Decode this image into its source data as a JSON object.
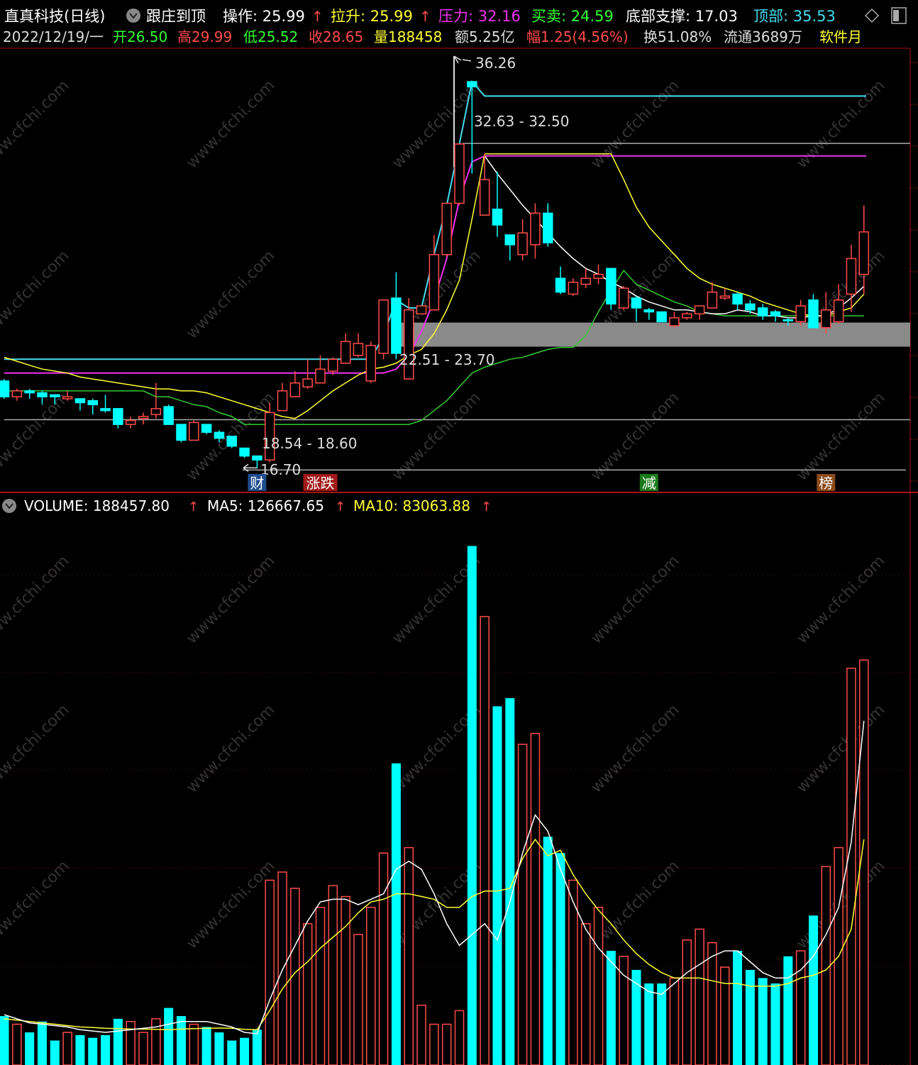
{
  "header": {
    "stock_name": "直真科技(日线)",
    "indicator_name": "跟庄到顶",
    "caozuo": "操作: 25.99",
    "lasheng": "拉升: 25.99",
    "yali": "压力: 32.16",
    "maimai": "买卖: 24.59",
    "dibu": "底部支撑: 17.03",
    "dingbu": "顶部: 35.53"
  },
  "info": {
    "date": "2022/12/19/一",
    "open": "开26.50",
    "high": "高29.99",
    "low": "低25.52",
    "close": "收28.65",
    "volume": "量188458",
    "amount": "额5.25亿",
    "change": "幅1.25(4.56%)",
    "turnover": "换51.08%",
    "float": "流通3689万",
    "sector": "软件月"
  },
  "annotations": {
    "high_label": "36.26",
    "resist_label": "32.63 - 32.50",
    "zone_label": "22.51 - 23.70",
    "support_label": "18.54 - 18.60",
    "low_label": "16.70"
  },
  "event_badges": [
    {
      "text": "财",
      "bg": "#1f4e8f",
      "x": 20
    },
    {
      "text": "涨跌",
      "bg": "#a01818",
      "x": 25
    },
    {
      "text": "减",
      "bg": "#1a7a1a",
      "x": 51
    },
    {
      "text": "榜",
      "bg": "#8a4a1a",
      "x": 65
    }
  ],
  "volume_header": {
    "label": "VOLUME: 188457.80",
    "ma5": "MA5: 126667.65",
    "ma10": "MA10: 83063.88"
  },
  "colors": {
    "up": "#ff4b4b",
    "down": "#00ffff",
    "ma_white": "#ffffff",
    "ma_yellow": "#ffff33",
    "ma_green": "#33cc33",
    "line_cyan": "#44ddee",
    "line_magenta": "#ee33ee",
    "zone_gray": "#8a8a8a",
    "frame": "#aa1111"
  },
  "chart_data": [
    {
      "type": "candlestick",
      "ylim": [
        15.6,
        37.7
      ],
      "candles": [
        {
          "o": 21.1,
          "c": 20.3,
          "h": 21.2,
          "l": 20.2,
          "up": false
        },
        {
          "o": 20.3,
          "c": 20.6,
          "h": 20.7,
          "l": 20.1,
          "up": true
        },
        {
          "o": 20.6,
          "c": 20.5,
          "h": 20.7,
          "l": 20.2,
          "up": false
        },
        {
          "o": 20.5,
          "c": 20.3,
          "h": 20.6,
          "l": 19.9,
          "up": false
        },
        {
          "o": 20.4,
          "c": 20.3,
          "h": 20.4,
          "l": 19.9,
          "up": false
        },
        {
          "o": 20.2,
          "c": 20.3,
          "h": 20.6,
          "l": 20.1,
          "up": true
        },
        {
          "o": 20.2,
          "c": 20.0,
          "h": 20.2,
          "l": 19.6,
          "up": false
        },
        {
          "o": 20.1,
          "c": 19.9,
          "h": 20.2,
          "l": 19.4,
          "up": false
        },
        {
          "o": 19.7,
          "c": 19.6,
          "h": 20.4,
          "l": 19.5,
          "up": false
        },
        {
          "o": 19.7,
          "c": 18.9,
          "h": 19.7,
          "l": 18.7,
          "up": false
        },
        {
          "o": 18.9,
          "c": 19.1,
          "h": 19.3,
          "l": 18.7,
          "up": true
        },
        {
          "o": 19.2,
          "c": 19.3,
          "h": 19.5,
          "l": 18.9,
          "up": true
        },
        {
          "o": 19.4,
          "c": 19.7,
          "h": 21.0,
          "l": 19.2,
          "up": true
        },
        {
          "o": 19.8,
          "c": 18.9,
          "h": 19.9,
          "l": 18.9,
          "up": false
        },
        {
          "o": 18.9,
          "c": 18.1,
          "h": 18.9,
          "l": 18.0,
          "up": false
        },
        {
          "o": 18.1,
          "c": 19.0,
          "h": 19.1,
          "l": 18.1,
          "up": true
        },
        {
          "o": 18.9,
          "c": 18.5,
          "h": 18.9,
          "l": 18.4,
          "up": false
        },
        {
          "o": 18.5,
          "c": 18.2,
          "h": 18.6,
          "l": 18.0,
          "up": false
        },
        {
          "o": 18.3,
          "c": 17.8,
          "h": 18.3,
          "l": 17.7,
          "up": false
        },
        {
          "o": 17.7,
          "c": 17.3,
          "h": 17.7,
          "l": 17.2,
          "up": false
        },
        {
          "o": 17.3,
          "c": 17.1,
          "h": 17.3,
          "l": 16.7,
          "up": false
        },
        {
          "o": 17.1,
          "c": 19.5,
          "h": 20.0,
          "l": 17.0,
          "up": true
        },
        {
          "o": 19.6,
          "c": 20.6,
          "h": 21.0,
          "l": 19.6,
          "up": true
        },
        {
          "o": 20.3,
          "c": 21.0,
          "h": 21.6,
          "l": 20.3,
          "up": true
        },
        {
          "o": 20.8,
          "c": 21.2,
          "h": 22.2,
          "l": 20.7,
          "up": true
        },
        {
          "o": 21.0,
          "c": 21.7,
          "h": 22.4,
          "l": 21.0,
          "up": true
        },
        {
          "o": 21.6,
          "c": 22.2,
          "h": 22.3,
          "l": 21.4,
          "up": true
        },
        {
          "o": 22.0,
          "c": 23.1,
          "h": 23.5,
          "l": 22.0,
          "up": true
        },
        {
          "o": 22.4,
          "c": 23.0,
          "h": 23.5,
          "l": 22.3,
          "up": true
        },
        {
          "o": 21.1,
          "c": 22.9,
          "h": 23.1,
          "l": 21.0,
          "up": true
        },
        {
          "o": 22.5,
          "c": 25.2,
          "h": 25.2,
          "l": 22.2,
          "up": true
        },
        {
          "o": 25.3,
          "c": 22.5,
          "h": 26.6,
          "l": 22.2,
          "up": false
        },
        {
          "o": 21.2,
          "c": 24.7,
          "h": 25.3,
          "l": 21.2,
          "up": true
        },
        {
          "o": 24.5,
          "c": 24.9,
          "h": 24.9,
          "l": 24.5,
          "up": true
        },
        {
          "o": 24.7,
          "c": 27.5,
          "h": 28.5,
          "l": 24.8,
          "up": true
        },
        {
          "o": 27.5,
          "c": 30.1,
          "h": 30.1,
          "l": 27.4,
          "up": true
        },
        {
          "o": 30.1,
          "c": 33.1,
          "h": 33.1,
          "l": 30.0,
          "up": true
        },
        {
          "o": 36.26,
          "c": 36.0,
          "h": 36.26,
          "l": 31.6,
          "up": false
        },
        {
          "o": 29.5,
          "c": 31.3,
          "h": 32.63,
          "l": 29.5,
          "up": true
        },
        {
          "o": 29.8,
          "c": 29.0,
          "h": 31.7,
          "l": 28.4,
          "up": false
        },
        {
          "o": 28.5,
          "c": 28.0,
          "h": 28.5,
          "l": 27.2,
          "up": false
        },
        {
          "o": 27.5,
          "c": 28.6,
          "h": 29.3,
          "l": 27.2,
          "up": true
        },
        {
          "o": 28.0,
          "c": 29.6,
          "h": 30.1,
          "l": 27.3,
          "up": true
        },
        {
          "o": 29.6,
          "c": 28.1,
          "h": 30.1,
          "l": 27.9,
          "up": false
        },
        {
          "o": 26.3,
          "c": 25.6,
          "h": 26.9,
          "l": 25.5,
          "up": false
        },
        {
          "o": 25.5,
          "c": 26.1,
          "h": 26.3,
          "l": 25.4,
          "up": true
        },
        {
          "o": 26.0,
          "c": 26.3,
          "h": 26.8,
          "l": 25.8,
          "up": true
        },
        {
          "o": 26.3,
          "c": 26.5,
          "h": 27.0,
          "l": 26.0,
          "up": true
        },
        {
          "o": 26.8,
          "c": 25.0,
          "h": 26.8,
          "l": 24.7,
          "up": false
        },
        {
          "o": 24.8,
          "c": 25.8,
          "h": 25.9,
          "l": 24.7,
          "up": true
        },
        {
          "o": 25.3,
          "c": 24.8,
          "h": 25.4,
          "l": 24.1,
          "up": false
        },
        {
          "o": 24.7,
          "c": 24.6,
          "h": 24.8,
          "l": 24.2,
          "up": false
        },
        {
          "o": 24.6,
          "c": 24.1,
          "h": 24.6,
          "l": 24.1,
          "up": false
        },
        {
          "o": 23.9,
          "c": 24.3,
          "h": 24.6,
          "l": 23.8,
          "up": true
        },
        {
          "o": 24.3,
          "c": 24.5,
          "h": 24.6,
          "l": 24.2,
          "up": true
        },
        {
          "o": 24.5,
          "c": 24.9,
          "h": 24.9,
          "l": 24.2,
          "up": true
        },
        {
          "o": 24.8,
          "c": 25.6,
          "h": 26.1,
          "l": 24.8,
          "up": true
        },
        {
          "o": 25.3,
          "c": 25.4,
          "h": 25.8,
          "l": 25.2,
          "up": true
        },
        {
          "o": 25.5,
          "c": 25.0,
          "h": 25.6,
          "l": 24.7,
          "up": false
        },
        {
          "o": 25.0,
          "c": 24.7,
          "h": 25.2,
          "l": 24.5,
          "up": false
        },
        {
          "o": 24.8,
          "c": 24.4,
          "h": 25.0,
          "l": 24.2,
          "up": false
        },
        {
          "o": 24.6,
          "c": 24.4,
          "h": 24.7,
          "l": 24.1,
          "up": false
        },
        {
          "o": 24.2,
          "c": 24.2,
          "h": 24.3,
          "l": 23.9,
          "up": false
        },
        {
          "o": 24.1,
          "c": 24.9,
          "h": 25.2,
          "l": 23.9,
          "up": true
        },
        {
          "o": 25.2,
          "c": 23.8,
          "h": 25.5,
          "l": 23.8,
          "up": false
        },
        {
          "o": 23.8,
          "c": 24.7,
          "h": 25.6,
          "l": 23.5,
          "up": true
        },
        {
          "o": 24.1,
          "c": 25.2,
          "h": 26.0,
          "l": 24.0,
          "up": true
        },
        {
          "o": 25.5,
          "c": 27.3,
          "h": 28.0,
          "l": 24.6,
          "up": true
        },
        {
          "o": 26.5,
          "c": 28.65,
          "h": 29.99,
          "l": 25.52,
          "up": true
        }
      ],
      "ma_white": [
        null,
        null,
        null,
        null,
        null,
        null,
        null,
        null,
        null,
        null,
        null,
        null,
        null,
        null,
        null,
        null,
        null,
        null,
        null,
        null,
        null,
        null,
        null,
        null,
        null,
        null,
        null,
        null,
        null,
        null,
        null,
        null,
        null,
        null,
        null,
        null,
        null,
        null,
        32.5,
        31.6,
        30.8,
        30.0,
        29.3,
        28.6,
        27.9,
        27.3,
        26.8,
        26.5,
        26.1,
        25.8,
        25.4,
        25.1,
        24.9,
        24.7,
        24.7,
        24.6,
        24.5,
        24.5,
        24.7,
        24.6,
        24.4,
        24.4,
        24.3,
        24.3,
        24.4,
        24.4,
        24.8,
        25.3,
        25.9
      ],
      "ma_yellow": [
        22.3,
        22.1,
        21.9,
        21.7,
        21.6,
        21.5,
        21.3,
        21.2,
        21.1,
        21.0,
        20.9,
        20.8,
        20.7,
        20.7,
        20.6,
        20.6,
        20.5,
        20.3,
        20.1,
        19.9,
        19.7,
        19.5,
        19.3,
        19.2,
        19.6,
        20.1,
        20.6,
        21.0,
        21.4,
        21.7,
        21.8,
        22.0,
        22.4,
        22.7,
        23.5,
        24.7,
        26.2,
        29.3,
        32.6,
        32.6,
        32.6,
        32.6,
        32.6,
        32.6,
        32.6,
        32.6,
        32.6,
        32.6,
        32.6,
        31.3,
        29.9,
        28.9,
        28.2,
        27.5,
        26.8,
        26.3,
        26.0,
        25.8,
        25.6,
        25.4,
        25.1,
        24.9,
        24.7,
        24.5,
        24.4,
        24.4,
        24.6,
        24.8,
        25.5
      ],
      "ma_green": [
        20.6,
        20.6,
        20.6,
        20.6,
        20.6,
        20.6,
        20.6,
        20.6,
        20.6,
        20.6,
        20.6,
        20.6,
        20.3,
        20.3,
        20.1,
        19.9,
        19.8,
        19.5,
        19.3,
        18.9,
        18.9,
        18.9,
        18.9,
        18.9,
        18.9,
        18.9,
        18.9,
        18.9,
        18.9,
        18.9,
        18.9,
        18.9,
        18.9,
        19.1,
        19.6,
        20.1,
        20.8,
        21.5,
        21.8,
        22.0,
        22.2,
        22.3,
        22.5,
        22.7,
        22.8,
        22.8,
        23.4,
        24.6,
        25.7,
        26.7,
        26.0,
        25.7,
        25.4,
        25.1,
        24.9,
        24.6,
        24.5,
        24.4,
        24.4,
        24.4,
        24.4,
        24.4,
        24.4,
        24.4,
        24.4,
        24.4,
        24.4,
        24.4,
        24.4
      ],
      "line_cyan": [
        22.2,
        22.2,
        22.2,
        22.2,
        22.2,
        22.2,
        22.2,
        22.2,
        22.2,
        22.2,
        22.2,
        22.2,
        22.2,
        22.2,
        22.2,
        22.2,
        22.2,
        22.2,
        22.2,
        22.2,
        22.2,
        22.2,
        22.2,
        22.2,
        22.2,
        22.2,
        22.2,
        22.2,
        22.2,
        22.2,
        23.4,
        25.2,
        24.8,
        24.8,
        27.5,
        30.0,
        33.1,
        36.26,
        35.53,
        35.53,
        35.53,
        35.53,
        35.53,
        35.53,
        35.53,
        35.53,
        35.53,
        35.53,
        35.53,
        35.53,
        35.53,
        35.53,
        35.53,
        35.53,
        35.53,
        35.53,
        35.53,
        35.53,
        35.53,
        35.53,
        35.53,
        35.53,
        35.53,
        35.53,
        35.53,
        35.53,
        35.53,
        35.53,
        35.53
      ],
      "line_magenta": [
        21.5,
        21.5,
        21.5,
        21.5,
        21.5,
        21.5,
        21.5,
        21.5,
        21.5,
        21.5,
        21.5,
        21.5,
        21.5,
        21.5,
        21.5,
        21.5,
        21.5,
        21.5,
        21.5,
        21.5,
        21.5,
        21.5,
        21.5,
        21.5,
        21.5,
        21.5,
        21.5,
        21.5,
        21.5,
        21.5,
        21.5,
        21.7,
        22.4,
        23.6,
        25.2,
        27.3,
        30.3,
        32.2,
        32.5,
        32.5,
        32.5,
        32.5,
        32.5,
        32.5,
        32.5,
        32.5,
        32.5,
        32.5,
        32.5,
        32.5,
        32.5,
        32.5,
        32.5,
        32.5,
        32.5,
        32.5,
        32.5,
        32.5,
        32.5,
        32.5,
        32.5,
        32.5,
        32.5,
        32.5,
        32.5,
        32.5,
        32.5,
        32.5,
        32.5
      ],
      "levels": {
        "top": 36.26,
        "resist": 32.63,
        "zone_low": 22.51,
        "zone_high": 23.7,
        "support": 18.6,
        "low": 16.7
      }
    },
    {
      "type": "bar",
      "ylim": [
        0,
        200000
      ],
      "volumes": [
        18000,
        15000,
        12000,
        16000,
        9000,
        12000,
        11000,
        10000,
        11000,
        17000,
        16000,
        12000,
        17000,
        21000,
        18000,
        15000,
        14000,
        12000,
        9000,
        10000,
        13000,
        68000,
        71000,
        65000,
        52000,
        58000,
        66000,
        62000,
        48000,
        58000,
        78000,
        111000,
        80000,
        22000,
        15000,
        15000,
        20000,
        191000,
        165000,
        132000,
        135000,
        118000,
        122000,
        84000,
        78000,
        68000,
        52000,
        58000,
        42000,
        40000,
        35000,
        30000,
        30000,
        32000,
        46000,
        50000,
        45000,
        36000,
        42000,
        35000,
        32000,
        30000,
        40000,
        42000,
        55000,
        73000,
        80000,
        146000,
        149000
      ],
      "ma5": [
        18500,
        17000,
        15500,
        15000,
        14500,
        14000,
        13000,
        12500,
        12000,
        12500,
        13000,
        13500,
        14000,
        15000,
        16000,
        16000,
        16000,
        15000,
        14000,
        12000,
        11500,
        24000,
        35000,
        44000,
        53000,
        60000,
        61000,
        61000,
        59000,
        61000,
        63000,
        72000,
        75000,
        72000,
        63000,
        52000,
        44000,
        48000,
        52000,
        46000,
        60000,
        78000,
        92000,
        86000,
        72000,
        60000,
        50000,
        43000,
        38000,
        33000,
        30000,
        27000,
        26000,
        30000,
        34000,
        37000,
        40000,
        42000,
        42000,
        38000,
        34000,
        32000,
        32000,
        35000,
        40000,
        48000,
        58000,
        82000,
        126667.65
      ],
      "ma10": [
        17000,
        16500,
        16000,
        15500,
        15000,
        14500,
        14000,
        13800,
        13500,
        13400,
        13200,
        13200,
        13100,
        13000,
        13200,
        13400,
        13500,
        13600,
        13500,
        13100,
        13000,
        20000,
        28000,
        34000,
        38000,
        43000,
        47000,
        51000,
        56000,
        60000,
        61000,
        63000,
        63000,
        62000,
        61000,
        58000,
        58000,
        62000,
        64000,
        64000,
        65000,
        76000,
        83000,
        77000,
        79000,
        70000,
        63000,
        57000,
        52000,
        46000,
        41000,
        37000,
        34000,
        32000,
        32000,
        32000,
        31000,
        30000,
        30000,
        29000,
        29000,
        29000,
        30000,
        32000,
        33000,
        35000,
        40000,
        50000,
        83063.88
      ]
    }
  ]
}
